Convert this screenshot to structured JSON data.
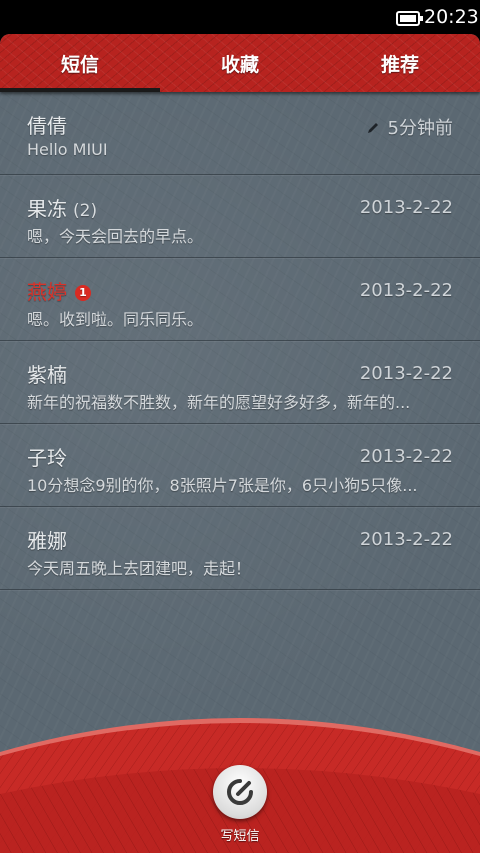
{
  "status_bar": {
    "time": "20:23"
  },
  "tabs": [
    {
      "label": "短信",
      "selected": true
    },
    {
      "label": "收藏",
      "selected": false
    },
    {
      "label": "推荐",
      "selected": false
    }
  ],
  "conversations": [
    {
      "name": "倩倩",
      "count": "",
      "unread_badge": "",
      "date": "5分钟前",
      "draft": true,
      "preview": "Hello MIUI"
    },
    {
      "name": "果冻",
      "count": "(2)",
      "unread_badge": "",
      "date": "2013-2-22",
      "draft": false,
      "preview": "嗯，今天会回去的早点。"
    },
    {
      "name": "燕婷",
      "count": "",
      "unread_badge": "1",
      "date": "2013-2-22",
      "draft": false,
      "preview": "嗯。收到啦。同乐同乐。"
    },
    {
      "name": "紫楠",
      "count": "",
      "unread_badge": "",
      "date": "2013-2-22",
      "draft": false,
      "preview": "新年的祝福数不胜数，新年的愿望好多好多，新年的..."
    },
    {
      "name": "子玲",
      "count": "",
      "unread_badge": "",
      "date": "2013-2-22",
      "draft": false,
      "preview": "10分想念9别的你，8张照片7张是你，6只小狗5只像..."
    },
    {
      "name": "雅娜",
      "count": "",
      "unread_badge": "",
      "date": "2013-2-22",
      "draft": false,
      "preview": "今天周五晚上去团建吧，走起！"
    }
  ],
  "compose": {
    "label": "写短信",
    "icon": "compose-icon"
  },
  "colors": {
    "accent_red": "#b7231f",
    "unread_name": "#d8332a",
    "badge": "#d92a22",
    "background": "#5b6872"
  }
}
